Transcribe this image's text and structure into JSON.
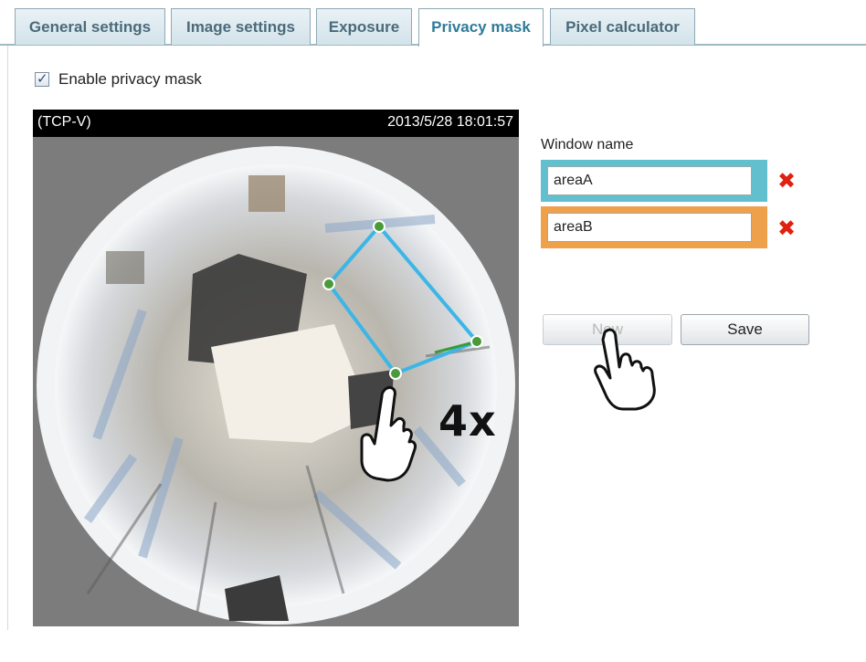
{
  "tabs": [
    {
      "label": "General settings",
      "active": false
    },
    {
      "label": "Image settings",
      "active": false
    },
    {
      "label": "Exposure",
      "active": false
    },
    {
      "label": "Privacy mask",
      "active": true
    },
    {
      "label": "Pixel calculator",
      "active": false
    }
  ],
  "privacy": {
    "enable_label": "Enable privacy mask",
    "enabled": true
  },
  "video": {
    "source_label": "(TCP-V)",
    "timestamp": "2013/5/28 18:01:57"
  },
  "windows": {
    "label": "Window name",
    "items": [
      {
        "name": "areaA",
        "color": "#62bfce"
      },
      {
        "name": "areaB",
        "color": "#efa04a"
      }
    ]
  },
  "buttons": {
    "new_label": "New",
    "save_label": "Save"
  },
  "annotation": {
    "repeat_badge": "4x"
  },
  "icons": [
    "checkbox-checked-icon",
    "delete-x-icon",
    "pointing-hand-icon"
  ],
  "colors": {
    "active_tab_text": "#2f7a9a",
    "mask_outline": "#3bb6e6",
    "mask_vertex": "#4a9a3a",
    "delete_icon": "#e02010"
  }
}
